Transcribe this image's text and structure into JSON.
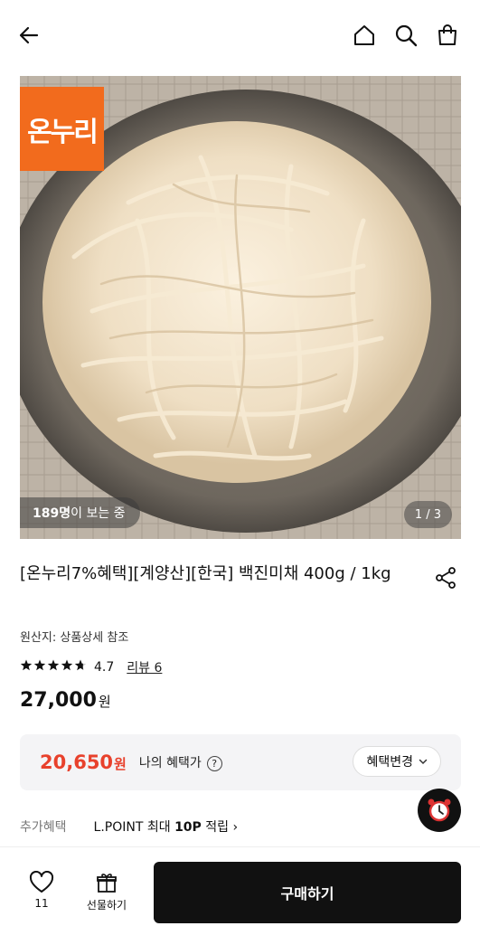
{
  "header": {
    "back_icon": "arrow-left-icon",
    "home_icon": "home-icon",
    "search_icon": "search-icon",
    "cart_icon": "shopping-bag-icon"
  },
  "hero": {
    "logo_text": "온누리",
    "logo_color": "#f26b1d",
    "viewers_count": "189명",
    "viewers_suffix": "이 보는 중",
    "pager": "1 / 3"
  },
  "product": {
    "title": "[온누리7%혜택][계양산][한국] 백진미채 400g / 1kg",
    "origin": "원산지: 상품상세 참조",
    "rating": "4.7",
    "rating_stars": 4.7,
    "reviews": "리뷰 6",
    "price": "27,000",
    "price_unit": "원"
  },
  "benefit": {
    "price": "20,650",
    "unit": "원",
    "label": "나의 혜택가",
    "help": "?",
    "change_label": "혜택변경",
    "accent": "#e8412c"
  },
  "extra": {
    "label": "추가혜택",
    "prefix": "L.POINT 최대 ",
    "points": "10P",
    "suffix": " 적립",
    "arrow": "›"
  },
  "bottom": {
    "like_count": "11",
    "gift_label": "선물하기",
    "buy_label": "구매하기"
  }
}
